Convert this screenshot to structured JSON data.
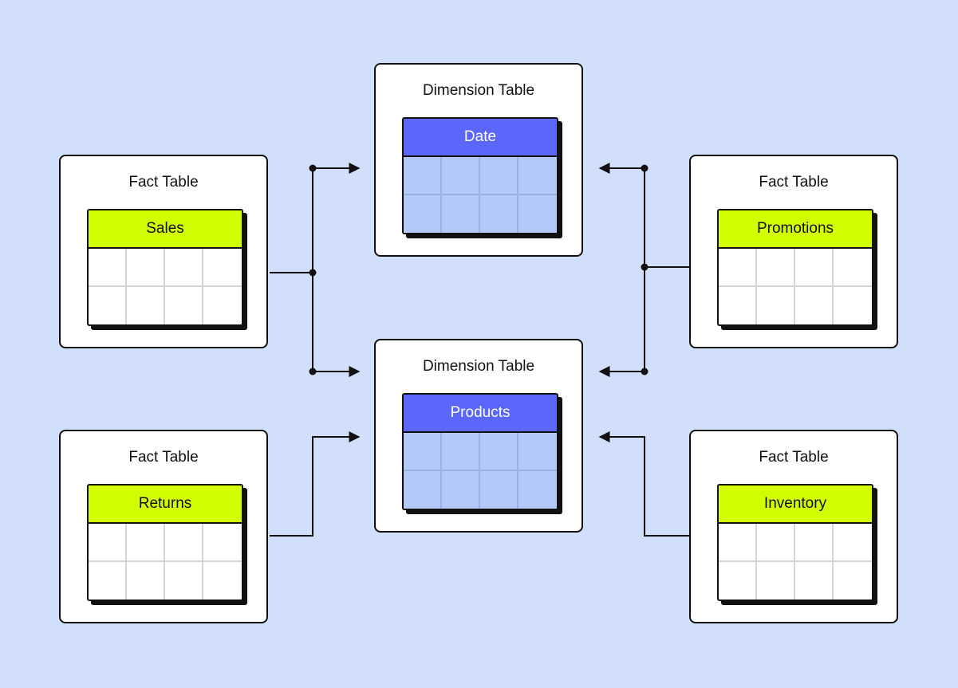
{
  "colors": {
    "background": "#d1dffa",
    "fact_header": "#d2ff00",
    "dimension_header": "#5a67fa",
    "dimension_cells": "#b4c9f8"
  },
  "fact_tables": [
    {
      "title": "Fact Table",
      "name": "Sales"
    },
    {
      "title": "Fact Table",
      "name": "Promotions"
    },
    {
      "title": "Fact Table",
      "name": "Returns"
    },
    {
      "title": "Fact Table",
      "name": "Inventory"
    }
  ],
  "dimension_tables": [
    {
      "title": "Dimension Table",
      "name": "Date"
    },
    {
      "title": "Dimension Table",
      "name": "Products"
    }
  ],
  "connections": [
    {
      "from": "Sales",
      "to": "Date"
    },
    {
      "from": "Sales",
      "to": "Products"
    },
    {
      "from": "Returns",
      "to": "Products"
    },
    {
      "from": "Promotions",
      "to": "Date"
    },
    {
      "from": "Promotions",
      "to": "Products"
    },
    {
      "from": "Inventory",
      "to": "Products"
    }
  ]
}
